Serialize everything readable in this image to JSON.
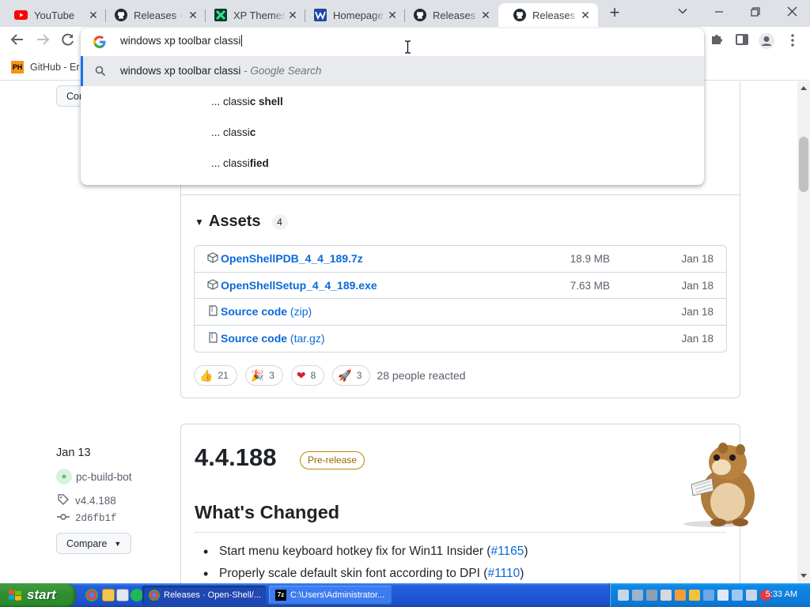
{
  "browser": {
    "tabs": [
      {
        "title": "YouTube",
        "icon": "youtube-icon",
        "active": false
      },
      {
        "title": "Releases · Open-Shell",
        "icon": "github-icon",
        "active": false
      },
      {
        "title": "XP Themes",
        "icon": "xp-themes-icon",
        "active": false
      },
      {
        "title": "Homepage",
        "icon": "homepage-icon",
        "active": false
      },
      {
        "title": "Releases · Open-Shell",
        "icon": "github-icon",
        "active": false
      },
      {
        "title": "Releases · Open-Shell",
        "icon": "github-icon",
        "active": true
      }
    ],
    "new_tab_label": "+",
    "omnibox": {
      "input_value": "windows xp toolbar classi",
      "suggestions": [
        {
          "text": "windows xp toolbar classi",
          "suffix": " - Google Search",
          "type": "search"
        },
        {
          "prefix": "... classi",
          "bold": "c shell",
          "type": "completion"
        },
        {
          "prefix": "... classi",
          "bold": "c",
          "type": "completion"
        },
        {
          "prefix": "... classi",
          "bold": "fied",
          "type": "completion"
        }
      ]
    },
    "bookmarks": [
      {
        "label": "GitHub - Er",
        "icon": "ph-icon",
        "icon_text": "PH"
      }
    ]
  },
  "page": {
    "partial_button_label": "Cor",
    "assets": {
      "heading": "Assets",
      "count": "4",
      "items": [
        {
          "name": "OpenShellPDB_4_4_189.7z",
          "sub": "",
          "size": "18.9 MB",
          "date": "Jan 18",
          "icon": "package-icon"
        },
        {
          "name": "OpenShellSetup_4_4_189.exe",
          "sub": "",
          "size": "7.63 MB",
          "date": "Jan 18",
          "icon": "package-icon"
        },
        {
          "name": "Source code",
          "sub": " (zip)",
          "size": "",
          "date": "Jan 18",
          "icon": "file-zip-icon"
        },
        {
          "name": "Source code",
          "sub": " (tar.gz)",
          "size": "",
          "date": "Jan 18",
          "icon": "file-zip-icon"
        }
      ]
    },
    "reactions": [
      {
        "emoji": "👍",
        "count": "21",
        "icon": "thumbs-up-icon"
      },
      {
        "emoji": "🎉",
        "count": "3",
        "icon": "party-popper-icon"
      },
      {
        "emoji": "❤",
        "count": "8",
        "icon": "heart-icon"
      },
      {
        "emoji": "🚀",
        "count": "3",
        "icon": "rocket-icon"
      }
    ],
    "reactions_summary": "28 people reacted",
    "release": {
      "date": "Jan 13",
      "author": "pc-build-bot",
      "tag": "v4.4.188",
      "commit": "2d6fb1f",
      "compare_label": "Compare",
      "title": "4.4.188",
      "badge": "Pre-release",
      "whats_changed": "What's Changed",
      "changes": [
        {
          "text": "Start menu keyboard hotkey fix for Win11 Insider (",
          "link": "#1165",
          "after": ")"
        },
        {
          "text": "Properly scale default skin font according to DPI (",
          "link": "#1110",
          "after": ")"
        }
      ]
    }
  },
  "taskbar": {
    "start_label": "start",
    "tasks": [
      {
        "label": "Releases · Open-Shell/...",
        "icon": "chrome-icon",
        "active": true
      },
      {
        "label": "C:\\Users\\Administrator...",
        "icon": "7zip-icon",
        "active": false
      }
    ],
    "clock": "5:33 AM"
  },
  "colors": {
    "link": "#0969da",
    "xp_taskbar": "#245edb",
    "xp_start": "#3c9a3c",
    "prerelease": "#9a6700"
  }
}
